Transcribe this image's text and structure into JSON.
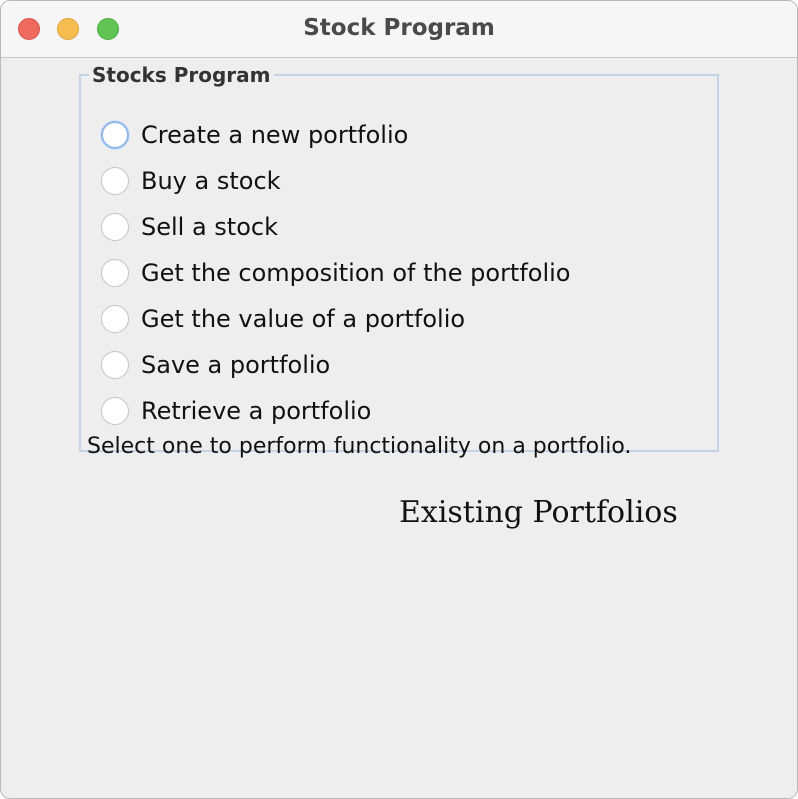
{
  "window": {
    "title": "Stock Program"
  },
  "panel": {
    "legend": "Stocks Program",
    "options": [
      {
        "label": "Create a new portfolio",
        "selected": false,
        "focused": true
      },
      {
        "label": "Buy a stock",
        "selected": false,
        "focused": false
      },
      {
        "label": "Sell a stock",
        "selected": false,
        "focused": false
      },
      {
        "label": "Get the composition of the portfolio",
        "selected": false,
        "focused": false
      },
      {
        "label": "Get the value of a portfolio",
        "selected": false,
        "focused": false
      },
      {
        "label": "Save a portfolio",
        "selected": false,
        "focused": false
      },
      {
        "label": "Retrieve a portfolio",
        "selected": false,
        "focused": false
      }
    ],
    "hint": "Select one to perform functionality on a portfolio."
  },
  "existing_portfolios": {
    "label": "Existing Portfolios"
  },
  "colors": {
    "close": "#ee6a5f",
    "minimize": "#f5bd4f",
    "zoom": "#61c454",
    "group_border": "#c3d4e8",
    "focus_ring": "#8fb6e8"
  }
}
